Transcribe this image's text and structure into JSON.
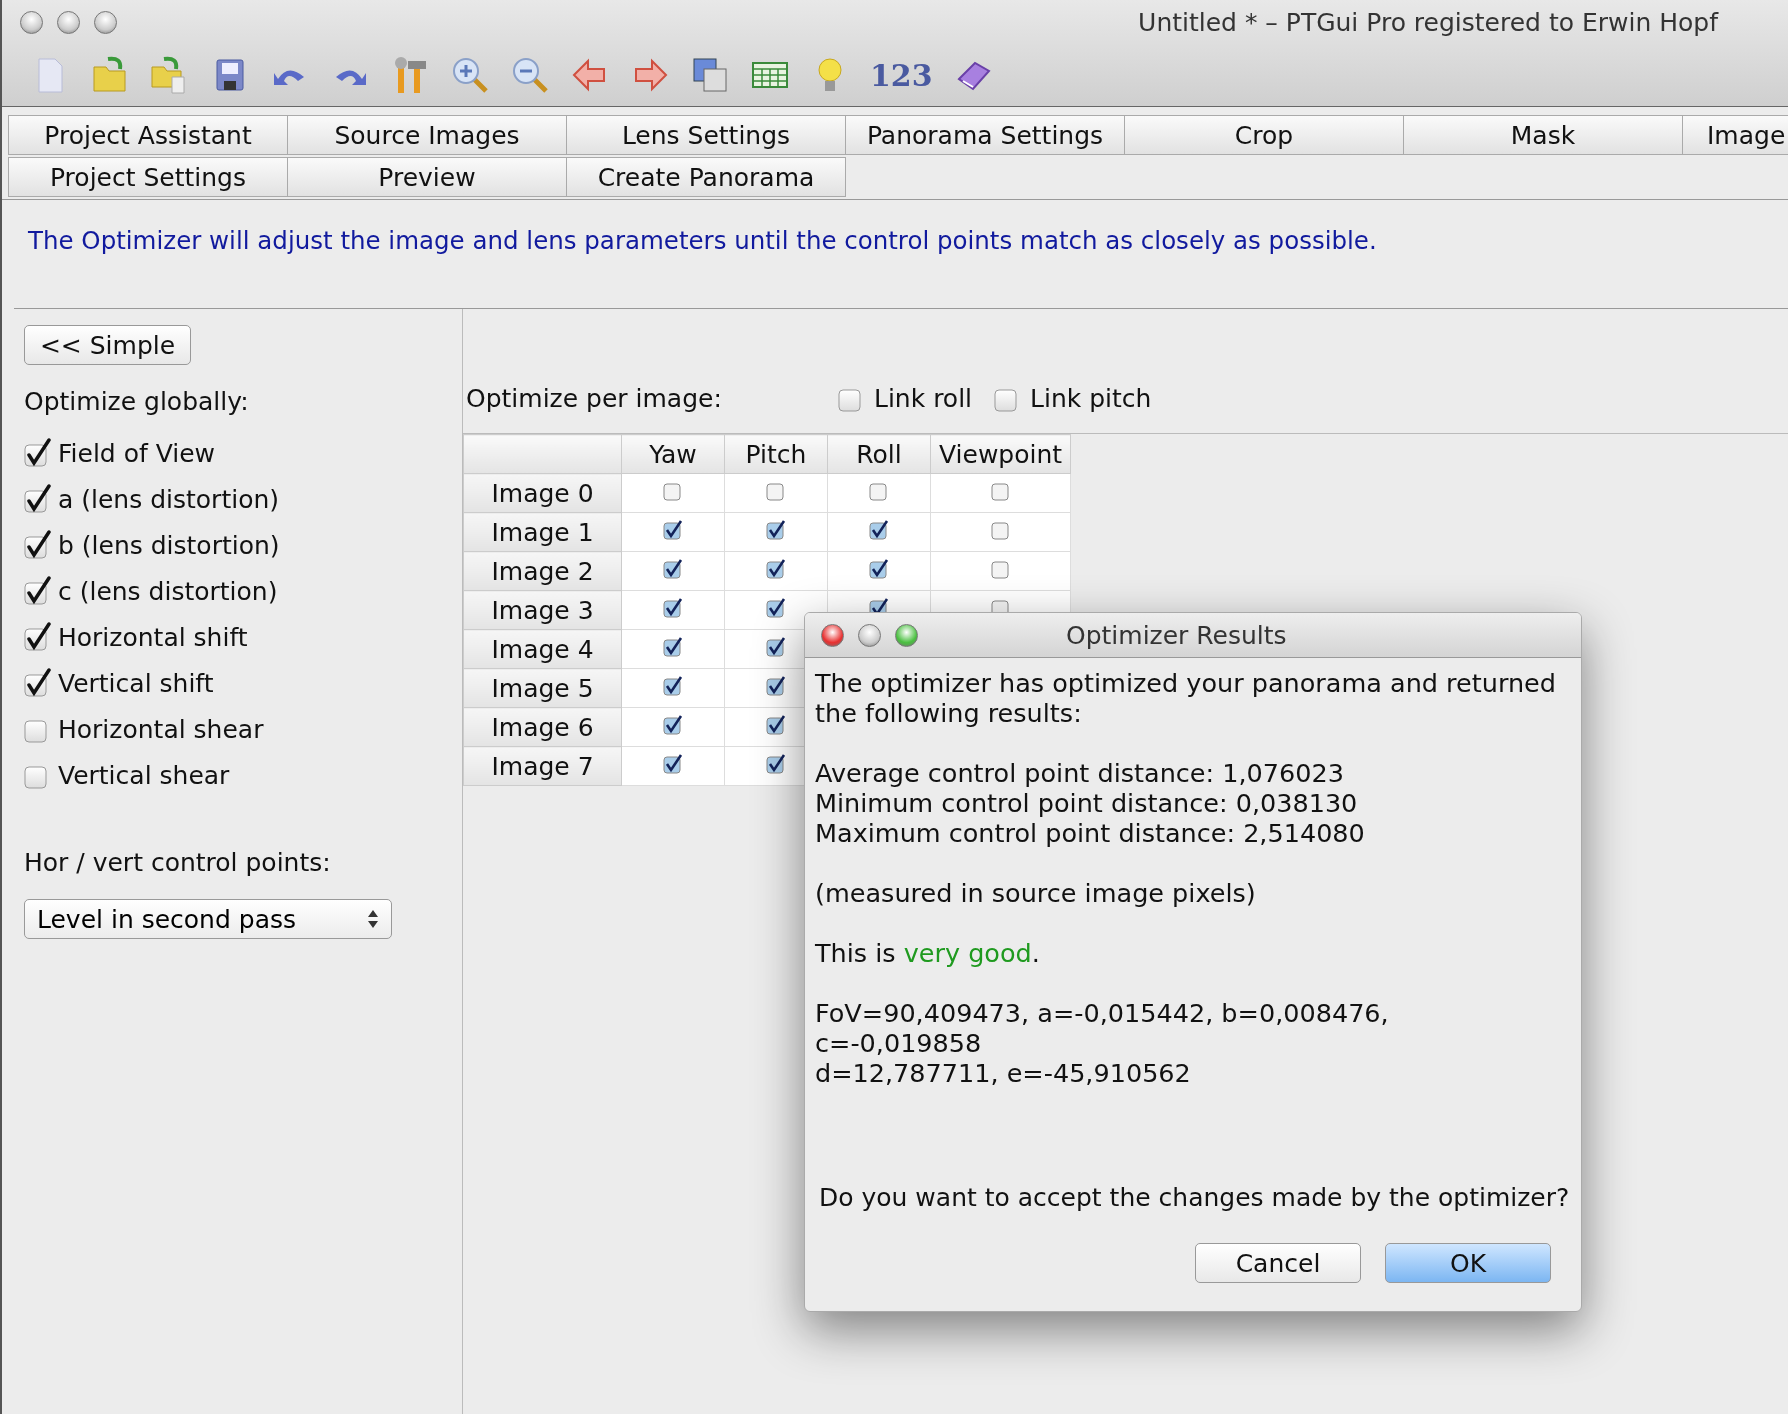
{
  "window": {
    "title": "Untitled * – PTGui Pro registered to Erwin Hopf"
  },
  "toolbar": {
    "numbers_label": "123"
  },
  "tab_rows": [
    [
      "Project Assistant",
      "Source Images",
      "Lens Settings",
      "Panorama Settings",
      "Crop",
      "Mask",
      "Image"
    ],
    [
      "Project Settings",
      "Preview",
      "Create Panorama"
    ]
  ],
  "info": "The Optimizer will adjust the image and lens parameters until the control points match as closely as possible.",
  "simple_button": "<< Simple",
  "optimize_globally": {
    "label": "Optimize globally:",
    "options": [
      {
        "label": "Field of View",
        "checked": true
      },
      {
        "label": "a (lens distortion)",
        "checked": true
      },
      {
        "label": "b (lens distortion)",
        "checked": true
      },
      {
        "label": "c (lens distortion)",
        "checked": true
      },
      {
        "label": "Horizontal shift",
        "checked": true
      },
      {
        "label": "Vertical shift",
        "checked": true
      },
      {
        "label": "Horizontal shear",
        "checked": false
      },
      {
        "label": "Vertical shear",
        "checked": false
      }
    ]
  },
  "control_points": {
    "label": "Hor / vert control points:",
    "value": "Level in second pass"
  },
  "per_image": {
    "label": "Optimize per image:",
    "links": [
      {
        "label": "Link roll",
        "checked": false
      },
      {
        "label": "Link pitch",
        "checked": false
      }
    ],
    "columns": [
      "Yaw",
      "Pitch",
      "Roll",
      "Viewpoint"
    ],
    "rows": [
      {
        "label": "Image 0",
        "cells": [
          false,
          false,
          false,
          false
        ]
      },
      {
        "label": "Image 1",
        "cells": [
          true,
          true,
          true,
          false
        ]
      },
      {
        "label": "Image 2",
        "cells": [
          true,
          true,
          true,
          false
        ]
      },
      {
        "label": "Image 3",
        "cells": [
          true,
          true,
          true,
          false
        ]
      },
      {
        "label": "Image 4",
        "cells": [
          true,
          true
        ]
      },
      {
        "label": "Image 5",
        "cells": [
          true,
          true
        ]
      },
      {
        "label": "Image 6",
        "cells": [
          true,
          true
        ]
      },
      {
        "label": "Image 7",
        "cells": [
          true,
          true
        ]
      }
    ]
  },
  "dialog": {
    "title": "Optimizer Results",
    "intro": "The optimizer has optimized your panorama and returned the following results:",
    "stats": [
      "Average control point distance: 1,076023",
      "Minimum control point distance: 0,038130",
      "Maximum control point distance: 2,514080"
    ],
    "note": "(measured in source image pixels)",
    "verdict": {
      "prefix": "This is",
      "rating": "very good",
      "suffix": ".",
      "color": "#1f9a1f"
    },
    "params": [
      "FoV=90,409473, a=-0,015442, b=0,008476,",
      "c=-0,019858",
      "d=12,787711, e=-45,910562"
    ],
    "question": "Do you want to accept the changes made by the optimizer?",
    "buttons": [
      {
        "label": "Cancel",
        "default": false
      },
      {
        "label": "OK",
        "default": true
      }
    ]
  }
}
